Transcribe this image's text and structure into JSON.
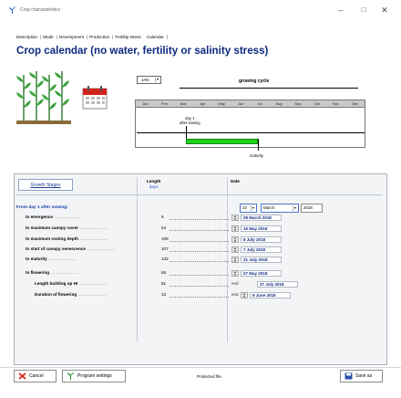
{
  "window": {
    "title": "Crop characteristics",
    "minimize": "–",
    "maximize": "□",
    "close": "✕"
  },
  "tabs": [
    "Description",
    "Mode",
    "Development",
    "Production",
    "Fertility stress",
    "Calendar"
  ],
  "page_title": "Crop calendar (no water, fertility or salinity stress)",
  "timeline": {
    "start_month": "JAN",
    "cycle_label": "growing cycle",
    "months": [
      "Jan",
      "Feb",
      "Mar",
      "Apr",
      "May",
      "Jun",
      "Jul",
      "Aug",
      "Sep",
      "Oct",
      "Nov",
      "Dec"
    ],
    "day1_label_line1": "day 1",
    "day1_label_line2": "after sowing",
    "maturity_label": "maturity",
    "cycle_start_fraction": 0.223,
    "cycle_end_fraction": 0.534,
    "cycle_color": "#22d31b"
  },
  "stages": {
    "button": "Growth Stages",
    "col_length": "Length",
    "col_length_unit": "days",
    "col_date": "Date",
    "from_day": "From day 1 after sowing:",
    "rows": [
      {
        "label": "to emergence",
        "value": "6",
        "date": "28 March 2018"
      },
      {
        "label": "to maximum canopy cover",
        "value": "54",
        "date": "15 May 2018"
      },
      {
        "label": "to maximum rooting depth",
        "value": "108",
        "date": "8 July 2018"
      },
      {
        "label": "to start of canopy senescence",
        "value": "107",
        "date": "7 July 2018"
      },
      {
        "label": "to maturity",
        "value": "132",
        "date": "31 July 2018"
      },
      {
        "label": "to flowering",
        "value": "66",
        "date": "27 May 2018"
      },
      {
        "label": "Length building up HI",
        "value": "81",
        "end_prefix": "end",
        "date": "27 July 2018"
      },
      {
        "label": "Duration of flowering",
        "value": "13",
        "end_prefix": "end",
        "date": "9 June 2018"
      }
    ],
    "sowing_date": {
      "day": "22",
      "month": "March",
      "year": "2018"
    }
  },
  "footer": {
    "cancel": "Cancel",
    "settings": "Program settings",
    "protected": "Protected file",
    "save": "Save as"
  },
  "colors": {
    "title": "#0d2a80",
    "accent_blue": "#1a3fa9",
    "cycle_green": "#22d31b"
  }
}
